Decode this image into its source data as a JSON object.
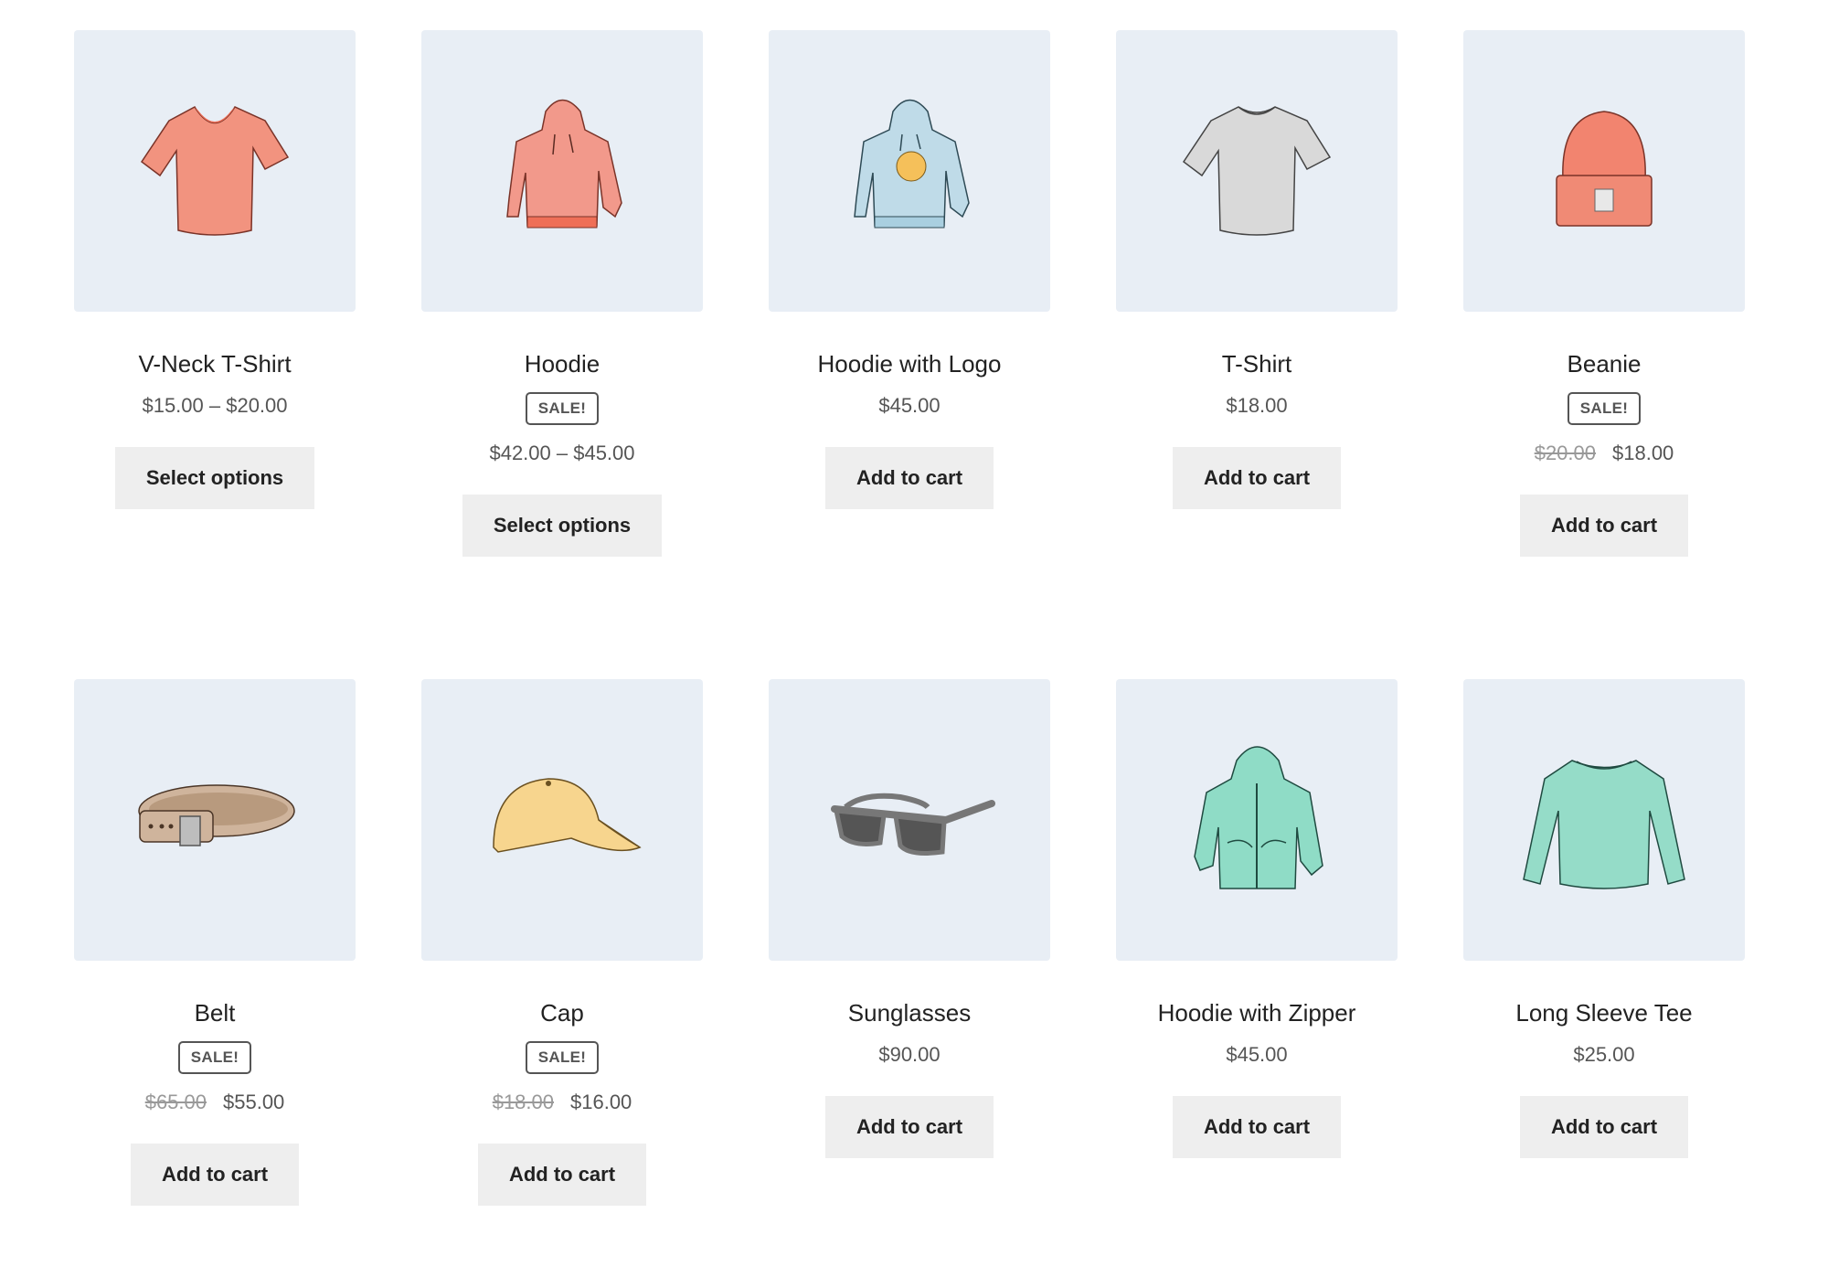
{
  "products": [
    {
      "name": "V-Neck T-Shirt",
      "sale": false,
      "price": "$15.00 – $20.00",
      "button": "Select options",
      "image": "vneck-tshirt-illustration",
      "color": "#f2937f"
    },
    {
      "name": "Hoodie",
      "sale": true,
      "badge": "SALE!",
      "price": "$42.00 – $45.00",
      "button": "Select options",
      "image": "hoodie-illustration",
      "color": "#f2998b"
    },
    {
      "name": "Hoodie with Logo",
      "sale": false,
      "price": "$45.00",
      "button": "Add to cart",
      "image": "hoodie-logo-illustration",
      "color": "#bfdbe8"
    },
    {
      "name": "T-Shirt",
      "sale": false,
      "price": "$18.00",
      "button": "Add to cart",
      "image": "tshirt-illustration",
      "color": "#d9d9d9"
    },
    {
      "name": "Beanie",
      "sale": true,
      "badge": "SALE!",
      "regular_price": "$20.00",
      "price": "$18.00",
      "button": "Add to cart",
      "image": "beanie-illustration",
      "color": "#f2846f"
    },
    {
      "name": "Belt",
      "sale": true,
      "badge": "SALE!",
      "regular_price": "$65.00",
      "price": "$55.00",
      "button": "Add to cart",
      "image": "belt-illustration",
      "color": "#cfb49c"
    },
    {
      "name": "Cap",
      "sale": true,
      "badge": "SALE!",
      "regular_price": "$18.00",
      "price": "$16.00",
      "button": "Add to cart",
      "image": "cap-illustration",
      "color": "#f7d58e"
    },
    {
      "name": "Sunglasses",
      "sale": false,
      "price": "$90.00",
      "button": "Add to cart",
      "image": "sunglasses-illustration",
      "color": "#8a8a8a"
    },
    {
      "name": "Hoodie with Zipper",
      "sale": false,
      "price": "$45.00",
      "button": "Add to cart",
      "image": "hoodie-zipper-illustration",
      "color": "#8fdcc6"
    },
    {
      "name": "Long Sleeve Tee",
      "sale": false,
      "price": "$25.00",
      "button": "Add to cart",
      "image": "long-sleeve-tee-illustration",
      "color": "#95dcc8"
    }
  ]
}
